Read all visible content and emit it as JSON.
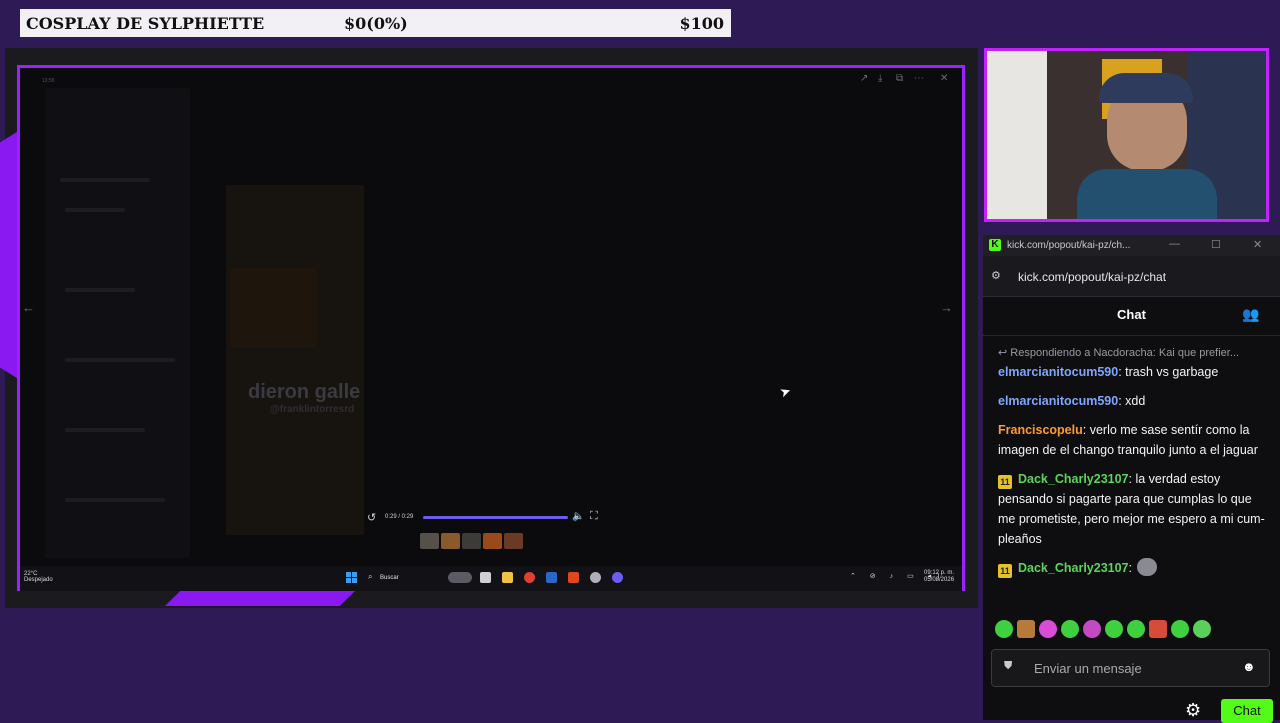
{
  "goal": {
    "title": "COSPLAY DE SYLPHIETTE",
    "progress": "$0(0%)",
    "target": "$100"
  },
  "desktop": {
    "time_small": "13:55",
    "viewer_text": "dieron galle",
    "viewer_handle": "@franklintorresrd",
    "video": {
      "time": "0:29 / 0:29",
      "progress_fraction": 1.0
    },
    "taskbar": {
      "temperature": "22°C",
      "weather": "Despejado",
      "search_label": "Buscar",
      "clock_time": "09:12 p. m.",
      "clock_date": "05/08/2026"
    }
  },
  "chat_window": {
    "title": "kick.com/popout/kai-pz/ch...",
    "url": "kick.com/popout/kai-pz/chat",
    "header": "Chat",
    "reply_to": "Respondiendo a Nacdoracha: Kai que prefier...",
    "messages": [
      {
        "user": "elmarcianitocum590",
        "text": " trash vs garbage",
        "color": "#7fa6ff",
        "badge": ""
      },
      {
        "user": "elmarcianitocum590",
        "text": " xdd",
        "color": "#7fa6ff",
        "badge": ""
      },
      {
        "user": "Franciscopelu",
        "text": " verlo me sase sentír como la imagen de el chango tranquilo junto a el jaguar",
        "color": "#ff9a2e",
        "badge": ""
      },
      {
        "user": "Dack_Charly23107",
        "text": " la verdad estoy pensando si pagarte para que cumplas lo que me prometiste, pero mejor me espero a mi cum-pleaños",
        "color": "#5bd45b",
        "badge": "11"
      },
      {
        "user": "Dack_Charly23107",
        "text": "",
        "color": "#5bd45b",
        "badge": "11"
      }
    ],
    "input_placeholder": "Enviar un mensaje",
    "send_label": "Chat",
    "accent": "#53fc18"
  }
}
